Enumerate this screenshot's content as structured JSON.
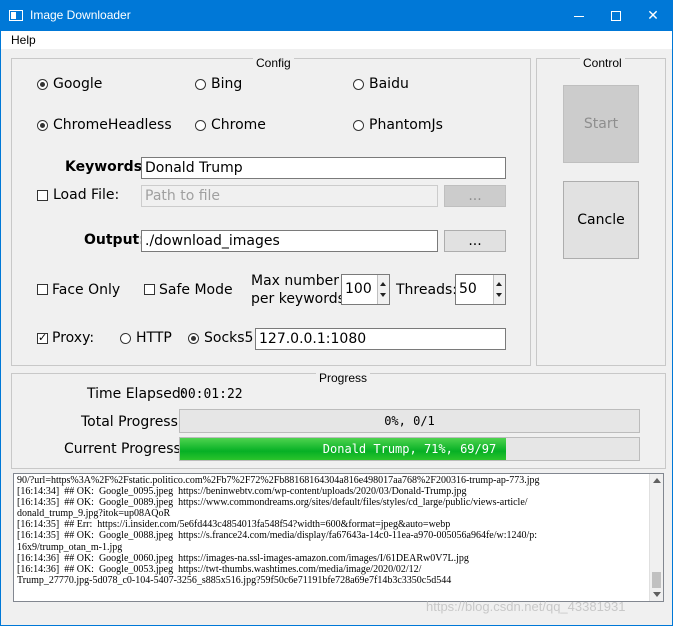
{
  "window": {
    "title": "Image Downloader",
    "min_glyph": "",
    "max_glyph": "",
    "close_glyph": "✕"
  },
  "menu": {
    "help": "Help"
  },
  "config": {
    "title": "Config",
    "engines": [
      {
        "label": "Google",
        "selected": true
      },
      {
        "label": "Bing",
        "selected": false
      },
      {
        "label": "Baidu",
        "selected": false
      }
    ],
    "drivers": [
      {
        "label": "ChromeHeadless",
        "selected": true
      },
      {
        "label": "Chrome",
        "selected": false
      },
      {
        "label": "PhantomJs",
        "selected": false
      }
    ],
    "keywords_label": "Keywords:",
    "keywords_value": "Donald Trump",
    "load_file_label": "Load File:",
    "load_file_checked": false,
    "load_file_placeholder": "Path to file",
    "browse_label": "...",
    "output_label": "Output:",
    "output_value": "./download_images",
    "output_browse_label": "...",
    "face_only_label": "Face Only",
    "face_only_checked": false,
    "safe_mode_label": "Safe Mode",
    "safe_mode_checked": false,
    "max_number_label_1": "Max number",
    "max_number_label_2": "per keywords",
    "max_number_value": "100",
    "threads_label": "Threads:",
    "threads_value": "50",
    "proxy_label": "Proxy:",
    "proxy_checked": true,
    "proxy_http_label": "HTTP",
    "proxy_socks_label": "Socks5",
    "proxy_type": "Socks5",
    "proxy_value": "127.0.0.1:1080"
  },
  "control": {
    "title": "Control",
    "start_label": "Start",
    "cancel_label": "Cancle"
  },
  "progress": {
    "title": "Progress",
    "time_label": "Time Elapsed:",
    "time_value": "00:01:22",
    "total_label": "Total Progress:",
    "total_text": "0%, 0/1",
    "total_fraction": 0.0,
    "current_label": "Current Progress:",
    "current_text": "Donald Trump, 71%, 69/97",
    "current_fraction": 0.71
  },
  "log": {
    "lines": [
      "90/?url=https%3A%2F%2Fstatic.politico.com%2Fb7%2F72%2Fb88168164304a816e498017aa768%2F200316-trump-ap-773.jpg",
      "[16:14:34]  ## OK:  Google_0095.jpeg  https://beninwebtv.com/wp-content/uploads/2020/03/Donald-Trump.jpg",
      "[16:14:35]  ## OK:  Google_0089.jpeg  https://www.commondreams.org/sites/default/files/styles/cd_large/public/views-article/",
      "donald_trump_9.jpg?itok=up08AQoR",
      "[16:14:35]  ## Err:  https://i.insider.com/5e6fd443c4854013fa548f54?width=600&format=jpeg&auto=webp",
      "[16:14:35]  ## OK:  Google_0088.jpeg  https://s.france24.com/media/display/fa67643a-14c0-11ea-a970-005056a964fe/w:1240/p:",
      "16x9/trump_otan_m-1.jpg",
      "[16:14:36]  ## OK:  Google_0060.jpeg  https://images-na.ssl-images-amazon.com/images/I/61DEARw0V7L.jpg",
      "[16:14:36]  ## OK:  Google_0053.jpeg  https://twt-thumbs.washtimes.com/media/image/2020/02/12/",
      "Trump_27770.jpg-5d078_c0-104-5407-3256_s885x516.jpg?59f50c6e71191bfe728a69e7f14b3c3350c5d544"
    ]
  },
  "watermark": "https://blog.csdn.net/qq_43381931",
  "colors": {
    "titlebar": "#0078d7",
    "progress_fill": "#06b025"
  }
}
